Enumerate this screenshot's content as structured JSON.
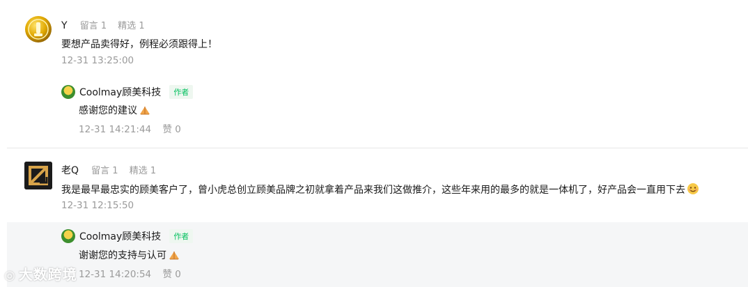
{
  "comments": [
    {
      "user": "Y",
      "stats": [
        "留言 1",
        "精选 1"
      ],
      "text": "要想产品卖得好，例程必须跟得上！",
      "time": "12-31 13:25:00",
      "reply": {
        "author": "Coolmay顾美科技",
        "badge": "作者",
        "text": "感谢您的建议",
        "time": "12-31 14:21:44",
        "likes": "赞 0"
      }
    },
    {
      "user": "老Q",
      "stats": [
        "留言 1",
        "精选 1"
      ],
      "text": "我是最早最忠实的顾美客户了，曾小虎总创立顾美品牌之初就拿着产品来我们这做推介，这些年来用的最多的就是一体机了，好产品会一直用下去",
      "time": "12-31 12:15:50",
      "reply": {
        "author": "Coolmay顾美科技",
        "badge": "作者",
        "text": "谢谢您的支持与认可",
        "time": "12-31 14:20:54",
        "likes": "赞 0"
      }
    }
  ],
  "watermark": "大数跨境",
  "colors": {
    "badge_text": "#07c160",
    "meta": "#9a9a9a",
    "highlight_bg": "#f5f6f7"
  }
}
